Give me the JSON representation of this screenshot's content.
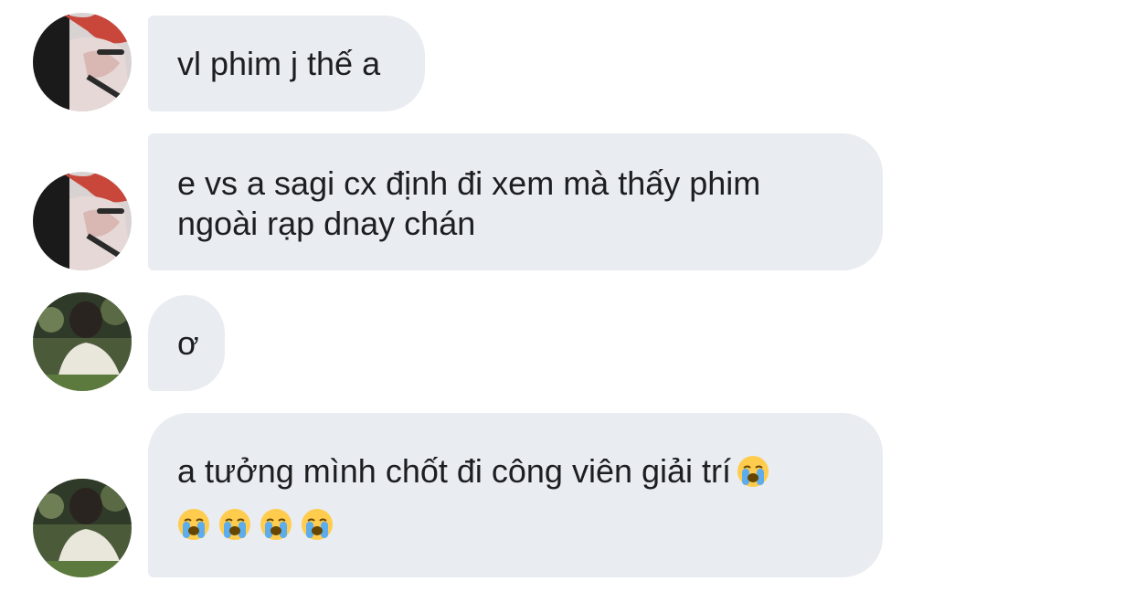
{
  "messages": [
    {
      "sender": "user-1",
      "text": "vl phim j thế a"
    },
    {
      "sender": "user-1",
      "text": "e vs a sagi cx định đi xem mà thấy phim\nngoài rạp dnay chán"
    },
    {
      "sender": "user-2",
      "text": "ơ"
    },
    {
      "sender": "user-2",
      "text": "a tưởng mình chốt đi công viên giải trí",
      "emoji": "loudly-crying-face",
      "emoji_count_line2": 4
    }
  ],
  "colors": {
    "bubble_bg": "#e9ecf0",
    "text": "#1c1e21"
  }
}
